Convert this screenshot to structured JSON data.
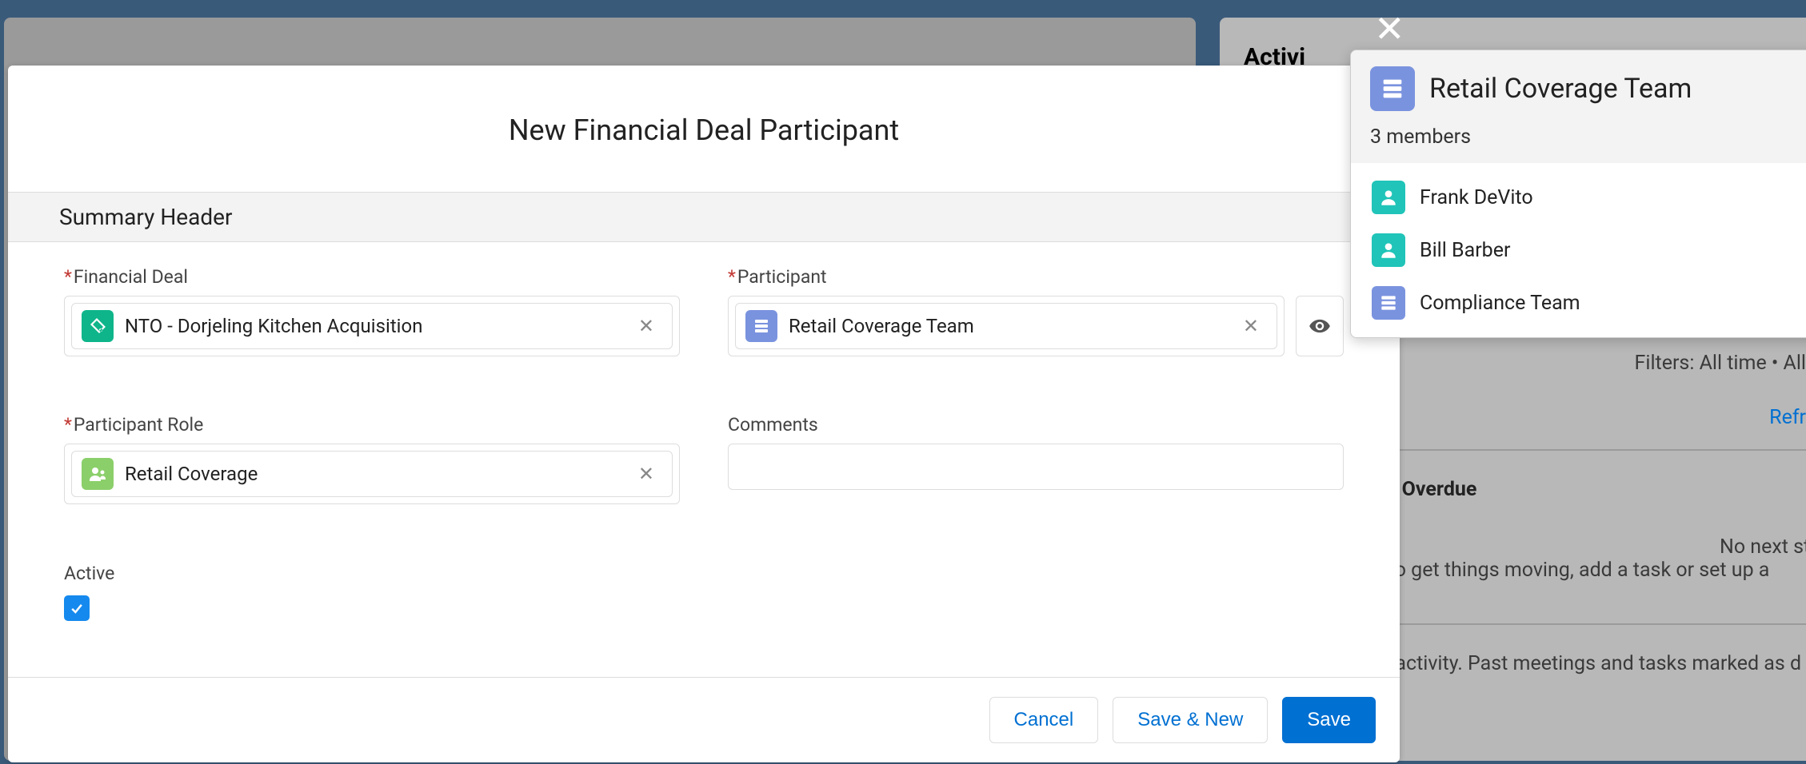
{
  "background": {
    "activity_label": "Activi",
    "filters_text": "Filters: All time • All",
    "refresh_text": "Refr",
    "overdue_text": " & Overdue",
    "no_steps_line1": "No next steps.",
    "no_steps_line2": "To get things moving, add a task or set up a",
    "past_activity": "t activity. Past meetings and tasks marked as d"
  },
  "modal": {
    "title": "New Financial Deal Participant",
    "section_header": "Summary Header",
    "fields": {
      "financial_deal": {
        "label": "Financial Deal",
        "value": "NTO - Dorjeling Kitchen Acquisition"
      },
      "participant": {
        "label": "Participant",
        "value": "Retail Coverage Team"
      },
      "participant_role": {
        "label": "Participant Role",
        "value": "Retail Coverage"
      },
      "comments": {
        "label": "Comments",
        "value": ""
      },
      "active": {
        "label": "Active",
        "checked": true
      }
    },
    "buttons": {
      "cancel": "Cancel",
      "save_new": "Save & New",
      "save": "Save"
    }
  },
  "popover": {
    "title": "Retail Coverage Team",
    "subtitle": "3 members",
    "members": [
      {
        "name": "Frank DeVito",
        "type": "user"
      },
      {
        "name": "Bill Barber",
        "type": "user"
      },
      {
        "name": "Compliance Team",
        "type": "team"
      }
    ]
  }
}
